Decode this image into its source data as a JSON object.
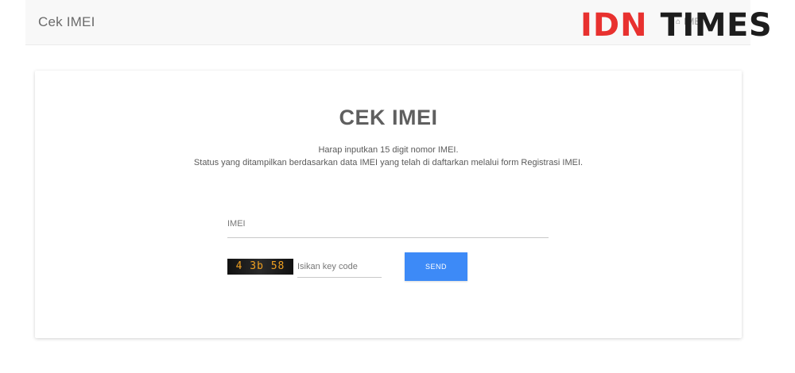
{
  "header": {
    "title": "Cek IMEI",
    "breadcrumb_home_icon": "home-icon",
    "breadcrumb_current": "IMEI"
  },
  "logo": {
    "idn": "IDN",
    "times": "TIMES",
    "colors": {
      "idn": "#e8312f",
      "times": "#1d1d1d"
    }
  },
  "card": {
    "title": "CEK IMEI",
    "desc_line1": "Harap inputkan 15 digit nomor IMEI.",
    "desc_line2": "Status yang ditampilkan berdasarkan data IMEI yang telah di daftarkan melalui form Registrasi IMEI."
  },
  "form": {
    "imei_placeholder": "IMEI",
    "imei_value": "",
    "captcha_text": "4 3b 58",
    "code_placeholder": "Isikan key code",
    "code_value": "",
    "send_label": "SEND",
    "accent_color": "#3d8af7"
  }
}
